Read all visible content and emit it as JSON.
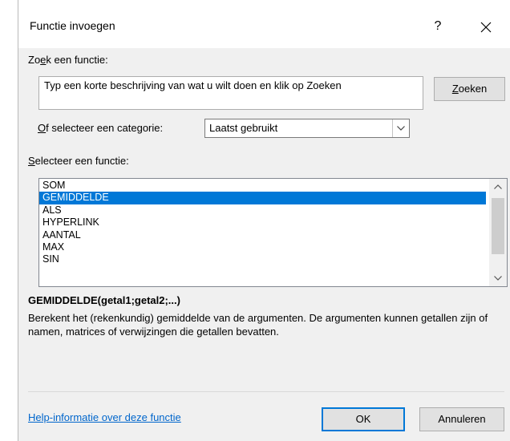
{
  "window": {
    "title": "Functie invoegen",
    "help_glyph": "?",
    "close_glyph": "✕"
  },
  "search": {
    "label_prefix": "Zo",
    "label_accel": "e",
    "label_rest": "k een functie:",
    "value": "Typ een korte beschrijving van wat u wilt doen en klik op Zoeken",
    "button_accel": "Z",
    "button_rest": "oeken"
  },
  "category": {
    "label_accel": "O",
    "label_rest": "f selecteer een categorie:",
    "selected": "Laatst gebruikt"
  },
  "function_list": {
    "label_accel": "S",
    "label_rest": "electeer een functie:",
    "items": [
      "SOM",
      "GEMIDDELDE",
      "ALS",
      "HYPERLINK",
      "AANTAL",
      "MAX",
      "SIN"
    ],
    "selected_index": 1
  },
  "details": {
    "signature": "GEMIDDELDE(getal1;getal2;...)",
    "description": "Berekent het (rekenkundig) gemiddelde van de argumenten. De argumenten kunnen getallen zijn of namen, matrices of verwijzingen die getallen bevatten."
  },
  "footer": {
    "help_link": "Help-informatie over deze functie",
    "ok_label": "OK",
    "cancel_label": "Annuleren"
  },
  "colors": {
    "selection": "#0078d7",
    "link": "#0066cc",
    "dialog_bg": "#f0f0f0"
  },
  "icons": {
    "dropdown": "chevron-down-icon",
    "scroll_up": "chevron-up-icon",
    "scroll_down": "chevron-down-icon"
  }
}
